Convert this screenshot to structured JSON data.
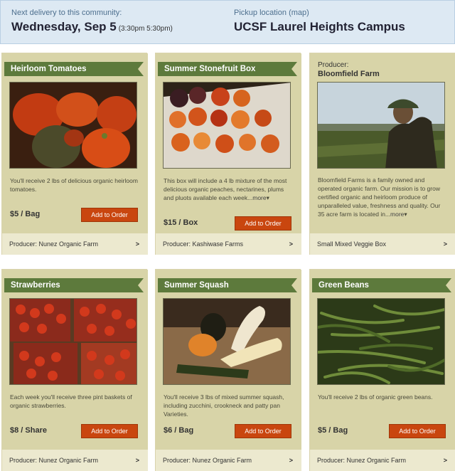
{
  "header": {
    "next_delivery_label": "Next delivery to this community:",
    "delivery_date": "Wednesday, Sep 5",
    "delivery_times": "(3:30pm 5:30pm)",
    "pickup_label": "Pickup location",
    "pickup_map_link": "(map)",
    "pickup_location": "UCSF Laurel Heights Campus"
  },
  "cards": [
    {
      "title": "Heirloom Tomatoes",
      "description": "You'll receive 2 lbs of delicious organic heirloom tomatoes.",
      "price": "$5 / Bag",
      "button": "Add to Order",
      "footer": "Producer: Nunez Organic Farm",
      "chevron": ">"
    },
    {
      "title": "Summer Stonefruit Box",
      "description": "This box will include a 4 lb mixture of the most delicious organic peaches, nectarines, plums and pluots available each week...",
      "more": "more",
      "price": "$15 / Box",
      "button": "Add to Order",
      "footer": "Producer: Kashiwase Farms",
      "chevron": ">"
    },
    {
      "producer_label": "Producer:",
      "producer_name": "Bloomfield Farm",
      "description": "Bloomfield Farms is a family owned and operated organic farm. Our mission is to grow certified organic and heirloom produce of unparalleled value, freshness and quality. Our 35 acre farm is located in...",
      "more": "more",
      "footer": "Small Mixed Veggie Box",
      "chevron": ">"
    },
    {
      "title": "Strawberries",
      "description": "Each week you'll receive three pint baskets of organic strawberries.",
      "price": "$8 / Share",
      "button": "Add to Order",
      "footer": "Producer: Nunez Organic Farm",
      "chevron": ">"
    },
    {
      "title": "Summer Squash",
      "description": "You'll receive 3 lbs of mixed summer squash, including zucchini, crookneck and patty pan Varieties.",
      "price": "$6 / Bag",
      "button": "Add to Order",
      "footer": "Producer: Nunez Organic Farm",
      "chevron": ">"
    },
    {
      "title": "Green Beans",
      "description": "You'll receive 2 lbs of organic green beans.",
      "price": "$5 / Bag",
      "button": "Add to Order",
      "footer": "Producer: Nunez Organic Farm",
      "chevron": ">"
    }
  ],
  "colors": {
    "ribbon": "#5d7a3c",
    "button": "#c9460f",
    "card_body": "#d8d4a8",
    "header_bg": "#dde9f3"
  }
}
